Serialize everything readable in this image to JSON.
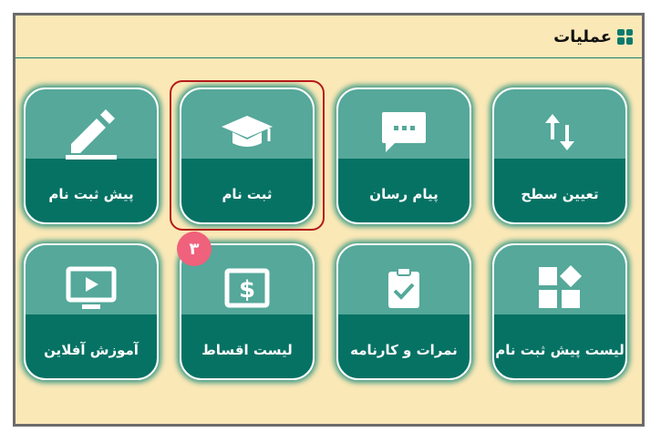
{
  "panel": {
    "title": "عملیات",
    "title_icon": "grid-icon"
  },
  "tiles": [
    {
      "label": "تعیین سطح",
      "icon": "sort-arrows-icon"
    },
    {
      "label": "پیام رسان",
      "icon": "chat-bubble-icon"
    },
    {
      "label": "ثبت نام",
      "icon": "graduation-cap-icon"
    },
    {
      "label": "پیش ثبت نام",
      "icon": "pencil-icon"
    },
    {
      "label": "لیست پیش ثبت نام",
      "icon": "shapes-icon"
    },
    {
      "label": "نمرات و کارنامه",
      "icon": "clipboard-check-icon"
    },
    {
      "label": "لیست اقساط",
      "icon": "money-bill-icon"
    },
    {
      "label": "آموزش آفلاین",
      "icon": "monitor-play-icon"
    }
  ],
  "badge": {
    "text": "۳"
  },
  "colors": {
    "tile_top": "#55a89a",
    "tile_bottom": "#067264",
    "background": "#fbe8b7",
    "highlight": "#b51a1a",
    "badge": "#f0617c"
  }
}
